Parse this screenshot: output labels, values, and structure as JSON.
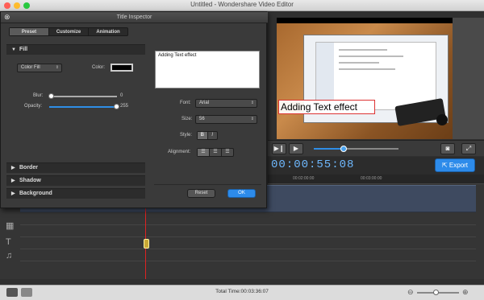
{
  "window": {
    "title": "Untitled - Wondershare Video Editor",
    "traffic_lights": [
      "#ff5f57",
      "#febc2e",
      "#28c840"
    ]
  },
  "inspector": {
    "title": "Title Inspector",
    "close_icon": "close-icon",
    "tabs": [
      {
        "label": "Preset",
        "active": true
      },
      {
        "label": "Customize",
        "active": false
      },
      {
        "label": "Animation",
        "active": false
      }
    ],
    "sections": {
      "fill": "Fill",
      "border": "Border",
      "shadow": "Shadow",
      "background": "Background"
    },
    "fill": {
      "type": "Color Fill",
      "color_label": "Color:",
      "color_value": "#000000",
      "blur_label": "Blur:",
      "blur_value": "0",
      "opacity_label": "Opacity:",
      "opacity_value": "255",
      "opacity_level": 1.0
    },
    "text": {
      "content": "Adding Text effect",
      "font_label": "Font:",
      "font_value": "Arial",
      "size_label": "Size:",
      "size_value": "56",
      "style_label": "Style:",
      "style_bold": "B",
      "style_italic": "I",
      "alignment_label": "Alignment:",
      "alignment_options": [
        "align-left-icon",
        "align-center-icon",
        "align-right-icon"
      ]
    },
    "buttons": {
      "reset": "Reset",
      "ok": "OK"
    }
  },
  "preview": {
    "caption": "Adding Text effect"
  },
  "playback": {
    "progress": 0.35,
    "timecode": "00:00:55:08"
  },
  "export": {
    "label": "Export"
  },
  "ruler": {
    "ticks": [
      "00:02:00:00",
      "00:03:00:00"
    ]
  },
  "status": {
    "total_time": "Total Time:00:03:36:07"
  },
  "colors": {
    "accent": "#2d8bea",
    "playhead": "#dd2222"
  }
}
